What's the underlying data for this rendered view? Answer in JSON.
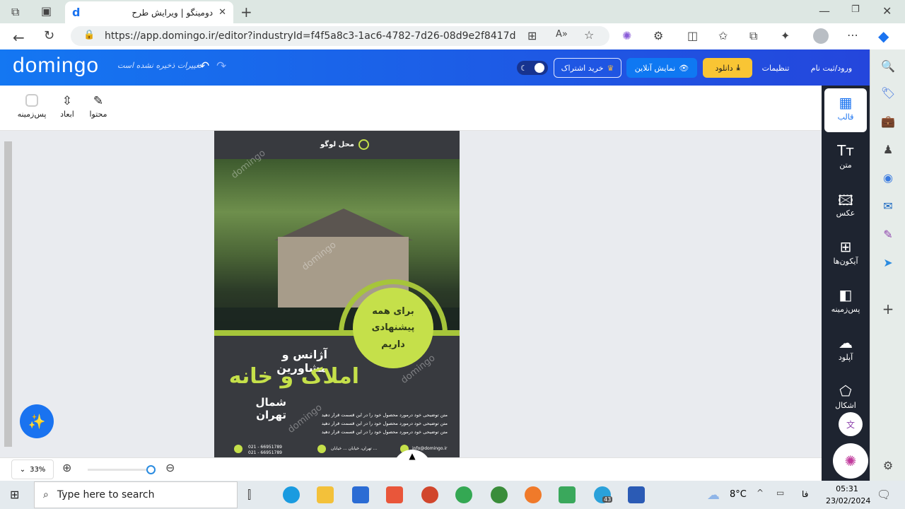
{
  "browser": {
    "tab_title": "دومینگو | ویرایش طرح",
    "url": "https://app.domingo.ir/editor?industryId=f4f5a8c3-1ac6-4782-7d26-08d9e2f8417d"
  },
  "header": {
    "logo": "domingo",
    "unsaved": "تغییرات ذخیره نشده است",
    "subscribe": "خرید اشتراک",
    "preview": "نمایش آنلاین",
    "download": "دانلود",
    "settings": "تنظیمات",
    "login": "ورود/ثبت نام"
  },
  "toolbar": {
    "content": "محتوا",
    "dimensions": "ابعاد",
    "background": "پس‌زمینه"
  },
  "sidebar": {
    "items": [
      {
        "label": "قالب",
        "icon": "layout-icon"
      },
      {
        "label": "متن",
        "icon": "text-icon"
      },
      {
        "label": "عکس",
        "icon": "image-icon"
      },
      {
        "label": "آیکون‌ها",
        "icon": "grid-icon"
      },
      {
        "label": "پس‌زمینه",
        "icon": "background-icon"
      },
      {
        "label": "آپلود",
        "icon": "upload-icon"
      },
      {
        "label": "اشکال",
        "icon": "shapes-icon"
      }
    ]
  },
  "poster": {
    "logo_place": "محل لوگو",
    "circle": [
      "برای همه",
      "پیشنهادی",
      "داریم"
    ],
    "line1": "آژانس و مشاورین",
    "line2": "املاک و خانه",
    "line3": "شمال تهران",
    "body": "متن توضیحی خود درمورد محصول خود را در این قسمت قرار دهید متن توضیحی خود درمورد محصول خود را در این قسمت قرار دهید متن توضیحی خود درمورد محصول خود را در این قسمت قرار دهید",
    "phone1": "021 - 66951789",
    "phone2": "021 - 66951789",
    "address": "تهران، خیابان ... خیابان ...",
    "email": "info@domingo.ir",
    "watermark": "domingo",
    "accent": "#c5e04a"
  },
  "zoom": {
    "level": "33%",
    "percent": 33
  },
  "taskbar": {
    "search_placeholder": "Type here to search",
    "weather": "8°C",
    "lang": "فا",
    "time": "05:31",
    "date": "23/02/2024",
    "telegram_badge": "43"
  }
}
